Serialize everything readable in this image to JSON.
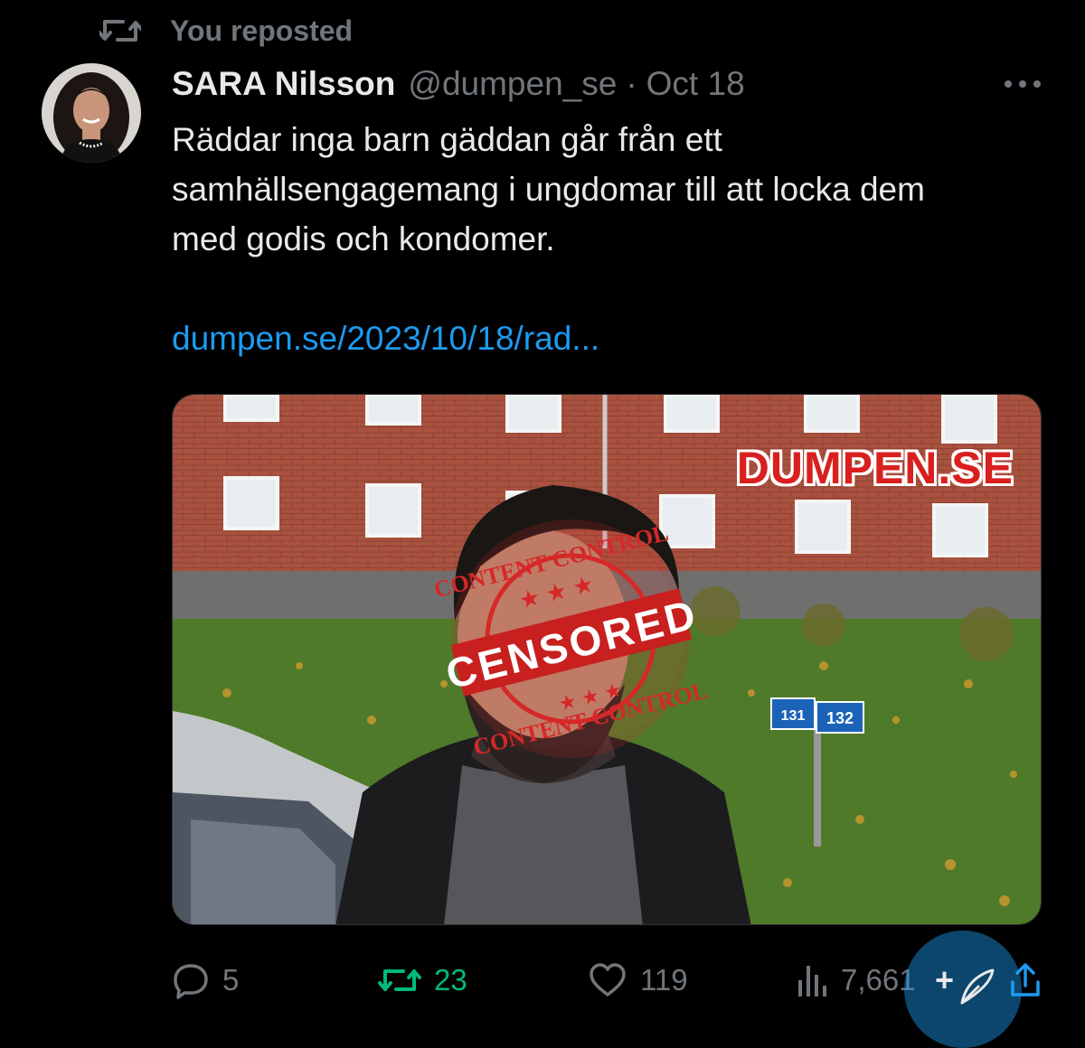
{
  "repost_banner": {
    "label": "You reposted",
    "icon": "retweet-icon"
  },
  "tweet": {
    "author_name": "SARA Nilsson",
    "author_handle": "@dumpen_se",
    "separator": "·",
    "date": "Oct 18",
    "text_lines": [
      "Räddar inga barn gäddan går från ett",
      "samhällsengagemang i ungdomar till att locka dem",
      "med godis och kondomer."
    ],
    "link_text": "dumpen.se/2023/10/18/rad...",
    "media": {
      "watermark": "DUMPEN.SE",
      "sign_numbers": [
        "131",
        "132"
      ],
      "stamp_text": [
        "CONTENT CONTROL",
        "CENSORED",
        "CONTENT CONTROL"
      ]
    }
  },
  "actions": {
    "replies": "5",
    "reposts": "23",
    "likes": "119",
    "views": "7,661",
    "reposted_color": "#00ba7c",
    "accent_color": "#1d9bf0"
  },
  "fab": {
    "label": "+",
    "icon": "compose-feather-icon"
  }
}
